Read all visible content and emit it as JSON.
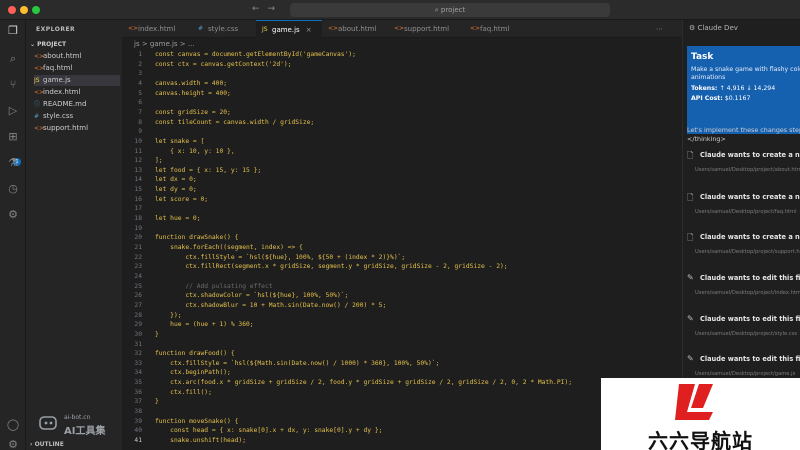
{
  "window": {
    "search_text": "project"
  },
  "explorer": {
    "title": "EXPLORER",
    "project": "PROJECT",
    "files": [
      {
        "name": "about.html",
        "icon": "html-icon"
      },
      {
        "name": "faq.html",
        "icon": "html-icon"
      },
      {
        "name": "game.js",
        "icon": "js-icon",
        "active": true
      },
      {
        "name": "index.html",
        "icon": "html-icon"
      },
      {
        "name": "README.md",
        "icon": "info-icon"
      },
      {
        "name": "style.css",
        "icon": "css-icon"
      },
      {
        "name": "support.html",
        "icon": "html-icon"
      }
    ],
    "outline": "OUTLINE"
  },
  "tabs": [
    {
      "label": "index.html"
    },
    {
      "label": "style.css"
    },
    {
      "label": "game.js",
      "active": true
    },
    {
      "label": "about.html"
    },
    {
      "label": "support.html"
    },
    {
      "label": "faq.html"
    }
  ],
  "breadcrumb": "js > game.js > ...",
  "code": [
    {
      "n": "1",
      "t": "const canvas = document.getElementById('gameCanvas');"
    },
    {
      "n": "2",
      "t": "const ctx = canvas.getContext('2d');"
    },
    {
      "n": "3",
      "t": ""
    },
    {
      "n": "4",
      "t": "canvas.width = 400;"
    },
    {
      "n": "5",
      "t": "canvas.height = 400;"
    },
    {
      "n": "6",
      "t": ""
    },
    {
      "n": "7",
      "t": "const gridSize = 20;"
    },
    {
      "n": "8",
      "t": "const tileCount = canvas.width / gridSize;"
    },
    {
      "n": "9",
      "t": ""
    },
    {
      "n": "10",
      "t": "let snake = ["
    },
    {
      "n": "11",
      "t": "    { x: 10, y: 10 },"
    },
    {
      "n": "12",
      "t": "];"
    },
    {
      "n": "13",
      "t": "let food = { x: 15, y: 15 };"
    },
    {
      "n": "14",
      "t": "let dx = 0;"
    },
    {
      "n": "15",
      "t": "let dy = 0;"
    },
    {
      "n": "16",
      "t": "let score = 0;"
    },
    {
      "n": "17",
      "t": ""
    },
    {
      "n": "18",
      "t": "let hue = 0;"
    },
    {
      "n": "19",
      "t": ""
    },
    {
      "n": "20",
      "t": "function drawSnake() {"
    },
    {
      "n": "21",
      "t": "    snake.forEach((segment, index) => {"
    },
    {
      "n": "22",
      "t": "        ctx.fillStyle = `hsl(${hue}, 100%, ${50 + (index * 2)}%)`;"
    },
    {
      "n": "23",
      "t": "        ctx.fillRect(segment.x * gridSize, segment.y * gridSize, gridSize - 2, gridSize - 2);"
    },
    {
      "n": "24",
      "t": ""
    },
    {
      "n": "25",
      "t": "        // Add pulsating effect"
    },
    {
      "n": "26",
      "t": "        ctx.shadowColor = `hsl(${hue}, 100%, 50%)`;"
    },
    {
      "n": "27",
      "t": "        ctx.shadowBlur = 10 + Math.sin(Date.now() / 200) * 5;"
    },
    {
      "n": "28",
      "t": "    });"
    },
    {
      "n": "29",
      "t": "    hue = (hue + 1) % 360;"
    },
    {
      "n": "30",
      "t": "}"
    },
    {
      "n": "31",
      "t": ""
    },
    {
      "n": "32",
      "t": "function drawFood() {"
    },
    {
      "n": "33",
      "t": "    ctx.fillStyle = `hsl(${Math.sin(Date.now() / 1000) * 360}, 100%, 50%)`;"
    },
    {
      "n": "34",
      "t": "    ctx.beginPath();"
    },
    {
      "n": "35",
      "t": "    ctx.arc(food.x * gridSize + gridSize / 2, food.y * gridSize + gridSize / 2, gridSize / 2, 0, 2 * Math.PI);"
    },
    {
      "n": "36",
      "t": "    ctx.fill();"
    },
    {
      "n": "37",
      "t": "}"
    },
    {
      "n": "38",
      "t": ""
    },
    {
      "n": "39",
      "t": "function moveSnake() {"
    },
    {
      "n": "40",
      "t": "    const head = { x: snake[0].x + dx, y: snake[0].y + dy };"
    },
    {
      "n": "41",
      "t": "    snake.unshift(head);"
    }
  ],
  "claude": {
    "header": "Claude Dev",
    "task_title": "Task",
    "task_desc": [
      "Make a snake game with flashy colors and",
      "animations"
    ],
    "tokens_label": "Tokens:",
    "tokens_value": "↑ 4,916 ↓ 14,294",
    "cost_label": "API Cost:",
    "cost_value": "$0.1167",
    "intro": [
      "Let's implement these changes step by step.",
      "</thinking>"
    ],
    "items": [
      {
        "icon": "file-plus-icon",
        "title": "Claude wants to create a new file:",
        "path": "Users/samuel/Desktop/project/about.html"
      },
      {
        "icon": "file-plus-icon",
        "title": "Claude wants to create a new file:",
        "path": "Users/samuel/Desktop/project/faq.html"
      },
      {
        "icon": "file-plus-icon",
        "title": "Claude wants to create a new file:",
        "path": "Users/samuel/Desktop/project/support.html"
      },
      {
        "icon": "pencil-icon",
        "title": "Claude wants to edit this file:",
        "path": "Users/samuel/Desktop/project/index.html"
      },
      {
        "icon": "pencil-icon",
        "title": "Claude wants to edit this file:",
        "path": "Users/samuel/Desktop/project/style.css"
      },
      {
        "icon": "pencil-icon",
        "title": "Claude wants to edit this file:",
        "path": "Users/samuel/Desktop/project/game.js"
      }
    ]
  },
  "watermarks": {
    "left_url": "ai-bot.cn",
    "left_name": "AI工具集",
    "right_name": "六六导航站"
  },
  "colors": {
    "accent": "#0e70c0",
    "code": "#e4c04c",
    "task_bg": "#1660b0",
    "logo_red": "#e02020"
  }
}
